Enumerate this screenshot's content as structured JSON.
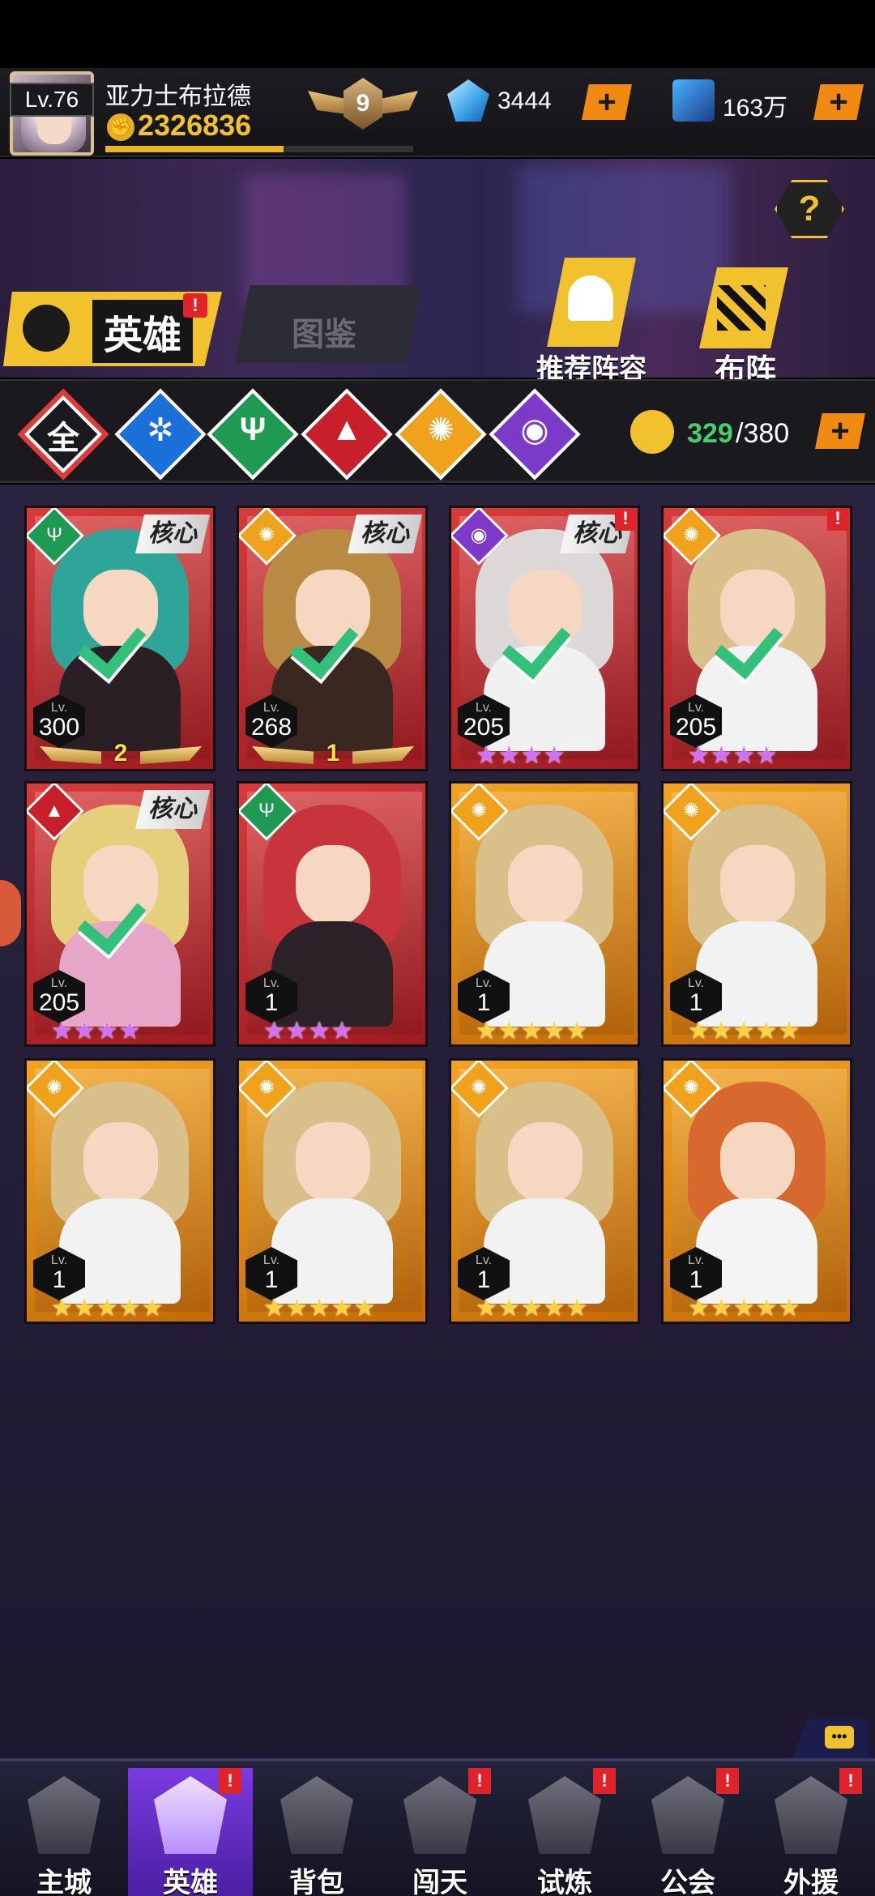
{
  "player": {
    "name": "亚力士布拉德",
    "level_label": "Lv.76",
    "power": "2326836",
    "vip_level": "9",
    "xp_progress_percent": 58
  },
  "resources": {
    "gems": "3444",
    "gold": "163万"
  },
  "help_label": "?",
  "tabs": {
    "heroes": "英雄",
    "codex": "图鉴"
  },
  "actions": {
    "recommend": "推荐阵容",
    "formation": "布阵"
  },
  "filters": {
    "all": "全"
  },
  "hero_count": {
    "current": "329",
    "max": "/380"
  },
  "colors": {
    "accent_yellow": "#f2c12e",
    "plus_orange": "#f08a10",
    "count_green": "#45d06a",
    "card_red": "#c82a2e",
    "card_gold": "#e0861a"
  },
  "cards": [
    {
      "lv_label": "Lv.",
      "level": "300",
      "core": "核心",
      "tier": "2"
    },
    {
      "lv_label": "Lv.",
      "level": "268",
      "core": "核心",
      "tier": "1"
    },
    {
      "lv_label": "Lv.",
      "level": "205",
      "core": "核心",
      "stars": "★★★★"
    },
    {
      "lv_label": "Lv.",
      "level": "205",
      "stars": "★★★★"
    },
    {
      "lv_label": "Lv.",
      "level": "205",
      "core": "核心",
      "stars": "★★★★"
    },
    {
      "lv_label": "Lv.",
      "level": "1",
      "stars": "★★★★"
    },
    {
      "lv_label": "Lv.",
      "level": "1",
      "stars": "★★★★★"
    },
    {
      "lv_label": "Lv.",
      "level": "1",
      "stars": "★★★★★"
    },
    {
      "lv_label": "Lv.",
      "level": "1",
      "stars": "★★★★★"
    },
    {
      "lv_label": "Lv.",
      "level": "1",
      "stars": "★★★★★"
    },
    {
      "lv_label": "Lv.",
      "level": "1",
      "stars": "★★★★★"
    },
    {
      "lv_label": "Lv.",
      "level": "1",
      "stars": "★★★★★"
    }
  ],
  "nav": {
    "city": "主城",
    "hero": "英雄",
    "bag": "背包",
    "stage": "闯天",
    "trial": "试炼",
    "guild": "公会",
    "support": "外援"
  }
}
